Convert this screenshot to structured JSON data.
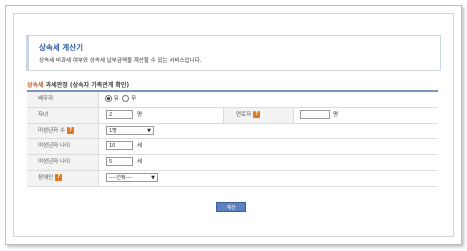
{
  "header": {
    "title": "상속세 계산기",
    "description": "상속세 비과세 여부와 상속세 납부금액을 계산할 수 있는 서비스입니다."
  },
  "section": {
    "accent": "상속세",
    "title": "과세판정 (상속자 가족관계 확인)"
  },
  "form": {
    "spouse": {
      "label": "배우자",
      "option_yes": "유",
      "option_no": "무",
      "selected": "유"
    },
    "children": {
      "label": "자녀",
      "value": "2",
      "unit": "명"
    },
    "parents": {
      "label": "연로자",
      "value": "",
      "unit": "명"
    },
    "minors": {
      "label": "미성년자 수",
      "value": "1명"
    },
    "minor_age_1": {
      "label": "미성년자 나이",
      "value": "10",
      "unit": "세"
    },
    "minor_age_2": {
      "label": "미성년자 나이",
      "value": "5",
      "unit": "세"
    },
    "disabled": {
      "label": "장애인",
      "value": "----선택----"
    }
  },
  "calc_button": "계산",
  "icons": {
    "help": "question-mark-icon",
    "accent_color": "#e07a1f"
  }
}
